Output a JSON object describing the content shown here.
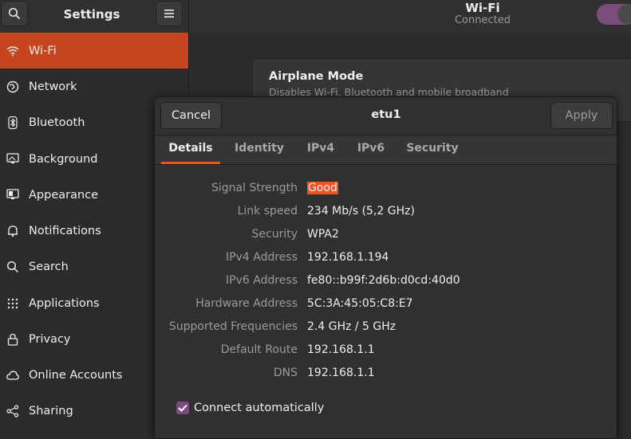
{
  "header": {
    "settings_title": "Settings",
    "panel_title": "Wi-Fi",
    "panel_subtitle": "Connected",
    "search_icon": "search-icon",
    "menu_icon": "hamburger-menu-icon"
  },
  "sidebar": {
    "items": [
      {
        "label": "Wi-Fi",
        "icon": "wifi-icon",
        "active": true
      },
      {
        "label": "Network",
        "icon": "network-icon"
      },
      {
        "label": "Bluetooth",
        "icon": "bluetooth-icon"
      },
      {
        "label": "Background",
        "icon": "background-icon"
      },
      {
        "label": "Appearance",
        "icon": "appearance-icon"
      },
      {
        "label": "Notifications",
        "icon": "bell-icon"
      },
      {
        "label": "Search",
        "icon": "search-icon"
      },
      {
        "label": "Applications",
        "icon": "grid-icon"
      },
      {
        "label": "Privacy",
        "icon": "lock-icon"
      },
      {
        "label": "Online Accounts",
        "icon": "cloud-icon"
      },
      {
        "label": "Sharing",
        "icon": "share-icon"
      }
    ]
  },
  "airplane": {
    "title": "Airplane Mode",
    "description": "Disables Wi-Fi, Bluetooth and mobile broadband"
  },
  "dialog": {
    "title": "etu1",
    "cancel_label": "Cancel",
    "apply_label": "Apply",
    "tabs": [
      "Details",
      "Identity",
      "IPv4",
      "IPv6",
      "Security"
    ],
    "active_tab": "Details",
    "details": [
      {
        "label": "Signal Strength",
        "value": "Good"
      },
      {
        "label": "Link speed",
        "value": "234 Mb/s (5,2 GHz)"
      },
      {
        "label": "Security",
        "value": "WPA2"
      },
      {
        "label": "IPv4 Address",
        "value": "192.168.1.194"
      },
      {
        "label": "IPv6 Address",
        "value": "fe80::b99f:2d6b:d0cd:40d0"
      },
      {
        "label": "Hardware Address",
        "value": "5C:3A:45:05:C8:E7"
      },
      {
        "label": "Supported Frequencies",
        "value": "2.4 GHz / 5 GHz"
      },
      {
        "label": "Default Route",
        "value": "192.168.1.1"
      },
      {
        "label": "DNS",
        "value": "192.168.1.1"
      }
    ],
    "connect_auto_label": "Connect automatically",
    "connect_auto_checked": true
  },
  "colors": {
    "accent": "#e95420",
    "active_sidebar": "#c7451e",
    "toggle_on": "#7a4d7a",
    "background": "#2b2b2b"
  }
}
